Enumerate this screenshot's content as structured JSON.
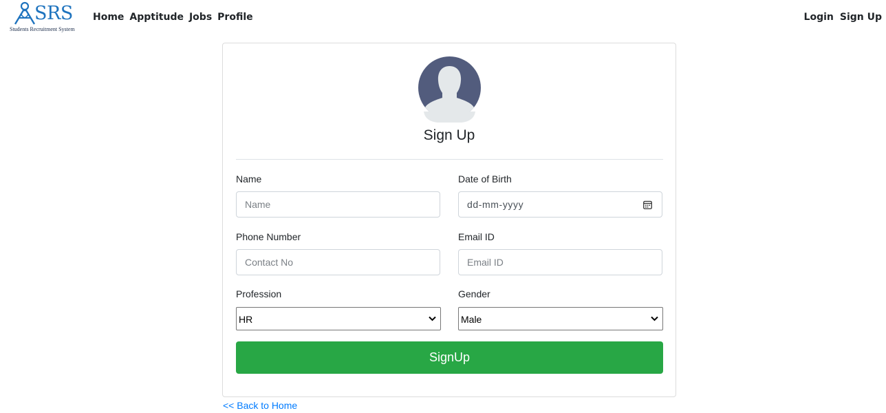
{
  "brand": {
    "logo_text": "SRS",
    "subtitle": "Students Recruitment System",
    "logo_icon": "person-a-logo-icon",
    "color": "#1e73be"
  },
  "nav": {
    "left": [
      {
        "label": "Home"
      },
      {
        "label": "Apptitude"
      },
      {
        "label": "Jobs"
      },
      {
        "label": "Profile"
      }
    ],
    "right": [
      {
        "label": "Login"
      },
      {
        "label": "Sign Up"
      }
    ]
  },
  "form": {
    "avatar_icon": "user-avatar-icon",
    "title": "Sign Up",
    "name": {
      "label": "Name",
      "placeholder": "Name",
      "value": ""
    },
    "dob": {
      "label": "Date of Birth",
      "value": "dd-mm-yyyy",
      "icon": "calendar-icon"
    },
    "phone": {
      "label": "Phone Number",
      "placeholder": "Contact No",
      "value": ""
    },
    "email": {
      "label": "Email ID",
      "placeholder": "Email ID",
      "value": ""
    },
    "profession": {
      "label": "Profession",
      "selected": "HR",
      "icon": "chevron-down-icon"
    },
    "gender": {
      "label": "Gender",
      "selected": "Male",
      "icon": "chevron-down-icon"
    },
    "submit_label": "SignUp",
    "submit_color": "#28a745"
  },
  "back_link": "<< Back to Home"
}
